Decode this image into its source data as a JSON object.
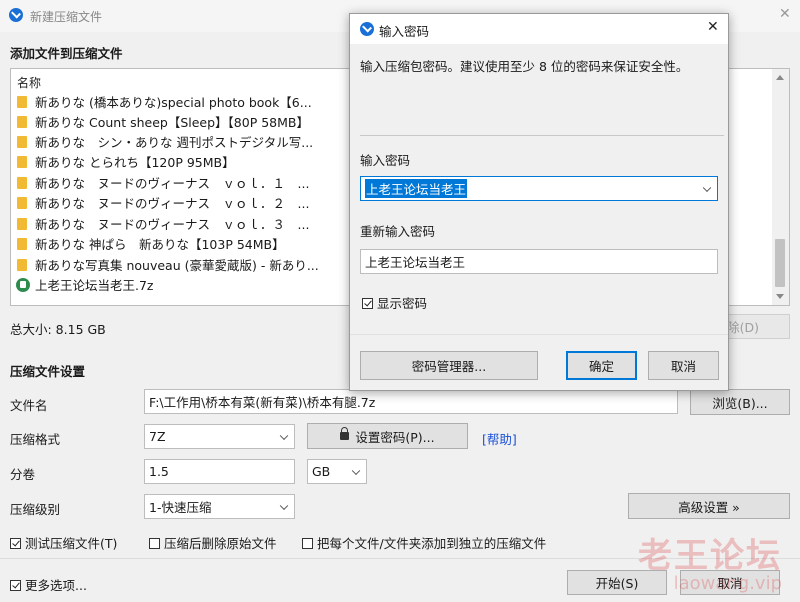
{
  "main_window": {
    "title": "新建压缩文件",
    "add_files_label": "添加文件到压缩文件",
    "file_list": {
      "column_header": "名称",
      "items": [
        {
          "type": "folder",
          "name": "新ありな (橋本ありな)special photo book【6..."
        },
        {
          "type": "folder",
          "name": "新ありな Count sheep【Sleep】【80P 58MB】"
        },
        {
          "type": "folder",
          "name": "新ありな　シン・ありな 週刊ポストデジタル写..."
        },
        {
          "type": "folder",
          "name": "新ありな とられち【120P 95MB】"
        },
        {
          "type": "folder",
          "name": "新ありな　ヌードのヴィーナス　ｖｏｌ．１　..."
        },
        {
          "type": "folder",
          "name": "新ありな　ヌードのヴィーナス　ｖｏｌ．２　..."
        },
        {
          "type": "folder",
          "name": "新ありな　ヌードのヴィーナス　ｖｏｌ．３　..."
        },
        {
          "type": "folder",
          "name": "新ありな 神ぱら　新ありな【103P 54MB】"
        },
        {
          "type": "folder",
          "name": "新ありな写真集 nouveau (豪華愛蔵版) - 新あり..."
        },
        {
          "type": "archive",
          "name": "上老王论坛当老王.7z"
        }
      ]
    },
    "total_size": "总大小: 8.15 GB",
    "delete_button": "除(D)",
    "settings_label": "压缩文件设置",
    "filename_label": "文件名",
    "filename_value": "F:\\工作用\\桥本有菜(新有菜)\\桥本有腿.7z",
    "browse_button": "浏览(B)...",
    "format_label": "压缩格式",
    "format_value": "7Z",
    "set_password_button": "设置密码(P)...",
    "help_link": "[帮助]",
    "split_label": "分卷",
    "split_value": "1.5",
    "split_unit": "GB",
    "level_label": "压缩级别",
    "level_value": "1-快速压缩",
    "advanced_button": "高级设置 »",
    "options": {
      "test_archive": "测试压缩文件(T)",
      "delete_after": "压缩后删除原始文件",
      "separate_archives": "把每个文件/文件夹添加到独立的压缩文件",
      "more_options": "更多选项..."
    },
    "start_button": "开始(S)",
    "cancel_button": "取消"
  },
  "password_dialog": {
    "title": "输入密码",
    "hint": "输入压缩包密码。建议使用至少 8 位的密码来保证安全性。",
    "password_label": "输入密码",
    "password_value": "上老王论坛当老王",
    "confirm_label": "重新输入密码",
    "confirm_value": "上老王论坛当老王",
    "show_password": "显示密码",
    "manager_button": "密码管理器...",
    "ok_button": "确定",
    "cancel_button": "取消"
  },
  "watermark": {
    "text": "老王论坛",
    "url": "laowang.vip"
  },
  "colors": {
    "accent": "#0078d7",
    "folder": "#f2b934",
    "link": "#1a4fd6",
    "app_icon": "#1a6fd6"
  }
}
